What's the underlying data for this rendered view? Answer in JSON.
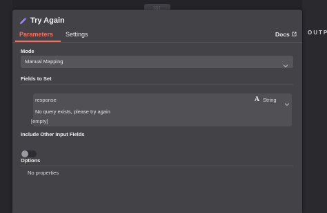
{
  "drag_handle": "∷∷",
  "output_label": "OUTPU",
  "panel": {
    "title": "Try Again",
    "tabs": [
      {
        "label": "Parameters",
        "active": true
      },
      {
        "label": "Settings",
        "active": false
      }
    ],
    "docs_label": "Docs",
    "mode": {
      "label": "Mode",
      "value": "Manual Mapping"
    },
    "fields_to_set": {
      "label": "Fields to Set",
      "field_name": "response",
      "field_type": "String",
      "type_icon": "A",
      "message": "No query exists, please try again",
      "empty_note": "[empty]"
    },
    "include_other": {
      "label": "Include Other Input Fields",
      "enabled": false
    },
    "options": {
      "label": "Options",
      "empty_text": "No properties"
    }
  },
  "colors": {
    "accent": "#ff6d5a",
    "panel_bg": "#434347",
    "page_bg": "#2b2b30",
    "icon_purple": "#9d8cf4"
  }
}
